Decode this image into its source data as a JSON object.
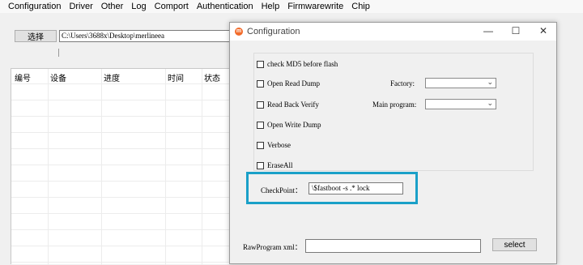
{
  "menubar": {
    "items": [
      "Configuration",
      "Driver",
      "Other",
      "Log",
      "Comport",
      "Authentication",
      "Help",
      "Firmwarewrite",
      "Chip"
    ]
  },
  "toolbar": {
    "select_label": "选择",
    "path_value": "C:\\Users\\3688x\\Desktop\\merlineea"
  },
  "grid": {
    "columns": [
      "编号",
      "设备",
      "进度",
      "时间",
      "状态"
    ]
  },
  "dialog": {
    "title": "Configuration",
    "minimize_glyph": "—",
    "maximize_glyph": "☐",
    "close_glyph": "✕",
    "options": {
      "check_md5": "check MD5 before flash",
      "open_read_dump": "Open Read Dump",
      "read_back_verify": "Read Back Verify",
      "open_write_dump": "Open Write Dump",
      "verbose": "Verbose",
      "erase_all": "EraseAll"
    },
    "factory_label": "Factory:",
    "main_program_label": "Main program:",
    "checkpoint_label": "CheckPoint：",
    "checkpoint_value": "\\$fastboot -s .* lock",
    "rawprogram_label": "RawProgram xml：",
    "rawprogram_value": "",
    "select_button": "select"
  },
  "colors": {
    "highlight": "#1aa0c8",
    "app_icon": "#f26b2a"
  }
}
